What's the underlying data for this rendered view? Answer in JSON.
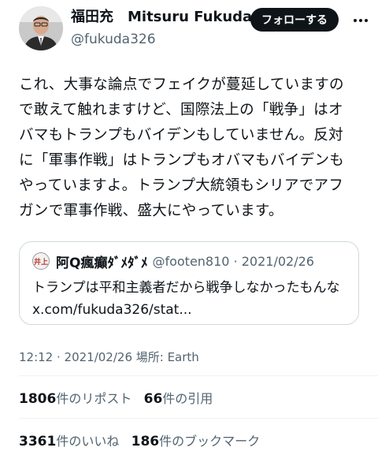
{
  "author": {
    "display_name": "福田充　Mitsuru Fukuda",
    "handle": "@fukuda326",
    "follow_label": "フォローする",
    "more_icon": "more-dots-icon"
  },
  "tweet": {
    "lines": [
      "これ、大事な論点でフェイクが蔓延していますの",
      "で敢えて触れますけど、国際法上の「戦争」はオ",
      "バマもトランプもバイデンもしていません。反対",
      "に「軍事作戦」はトランプもオバマもバイデンも",
      "やっていますよ。トランプ大統領もシリアでアフ",
      "ガンで軍事作戦、盛大にやっています。"
    ]
  },
  "quote": {
    "avatar_text": "井上",
    "name": "阿Q瘋癲ﾀﾞﾒﾀﾞﾒ",
    "meta": "@footen810 · 2021/02/26",
    "lines": [
      "トランプは平和主義者だから戦争しなかったもんな",
      "x.com/fukuda326/stat..."
    ]
  },
  "timestamp": "12:12 · 2021/02/26 場所: Earth",
  "stats": {
    "reposts_count": "1806",
    "reposts_label": "件のリポスト",
    "quotes_count": "66",
    "quotes_label": "件の引用",
    "likes_count": "3361",
    "likes_label": "件のいいね",
    "bookmarks_count": "186",
    "bookmarks_label": "件のブックマーク"
  }
}
